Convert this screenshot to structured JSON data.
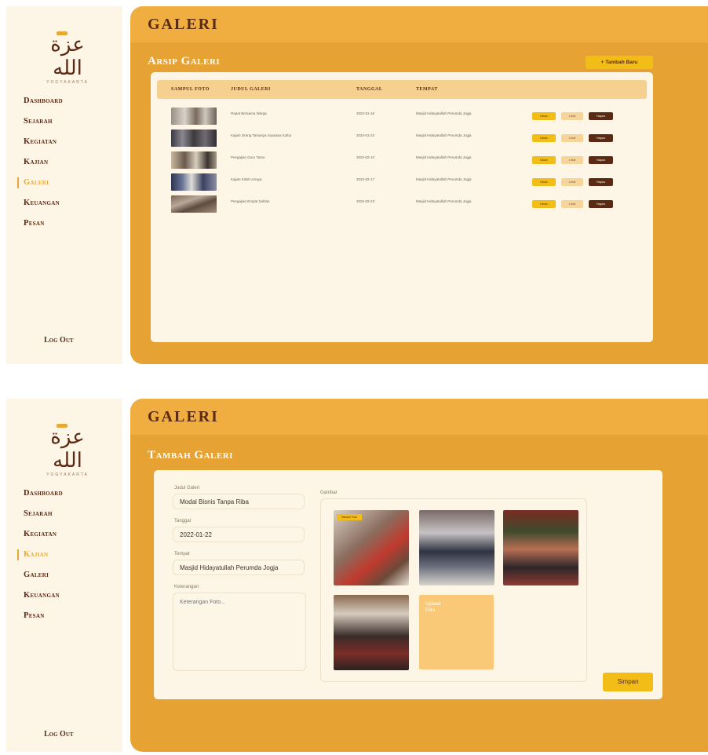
{
  "screens": [
    {
      "sidebar": {
        "logo_text": "عزة الله",
        "logo_sub": "YOGYAKARTA",
        "nav": [
          "Dashboard",
          "Sejarah",
          "Kegiatan",
          "Kajian",
          "Galeri",
          "Keuangan",
          "Pesan"
        ],
        "active": "Galeri",
        "logout": "Log Out"
      },
      "header": {
        "title": "GALERI"
      },
      "section_title": "Arsip Galeri",
      "add_button": "+ Tambah Baru",
      "table": {
        "columns": [
          "SAMPUL FOTO",
          "JUDUL GALERI",
          "TANGGAL",
          "TEMPAT"
        ],
        "rows": [
          {
            "title": "Rapat Bersama Warga",
            "date": "2022-01-16",
            "place": "Masjid Hidayatullah Perumda Jogja"
          },
          {
            "title": "Kajian Orang Tamasya Suasana Kultur",
            "date": "2022-01-23",
            "place": "Masjid Hidayatullah Perumda Jogja"
          },
          {
            "title": "Pengajian Guru Tamu",
            "date": "2022-02-10",
            "place": "Masjid Hidayatullah Perumda Jogja"
          },
          {
            "title": "Kajian Kitab Umaya",
            "date": "2022-02-17",
            "place": "Masjid Hidayatullah Perumda Jogja"
          },
          {
            "title": "Pengajian Empat Sahlan",
            "date": "2022-02-23",
            "place": "Masjid Hidayatullah Perumda Jogja"
          }
        ],
        "actions": {
          "edit": "Ubah",
          "view": "Lihat",
          "delete": "Hapus"
        }
      }
    },
    {
      "sidebar": {
        "logo_text": "عزة الله",
        "logo_sub": "YOGYAKARTA",
        "nav": [
          "Dashboard",
          "Sejarah",
          "Kegiatan",
          "Kajian",
          "Galeri",
          "Keuangan",
          "Pesan"
        ],
        "active": "Kajian",
        "logout": "Log Out"
      },
      "header": {
        "title": "GALERI"
      },
      "section_title": "Tambah Galeri",
      "form": {
        "title_label": "Judul Galeri",
        "title_value": "Modal Bisnis Tanpa Riba",
        "date_label": "Tanggal",
        "date_value": "2022-01-22",
        "place_label": "Tempat",
        "place_value": "Masjid Hidayatullah Perumda Jogja",
        "desc_label": "Keterangan",
        "desc_placeholder": "Keterangan Foto...",
        "gallery_label": "Gambar",
        "badge_text": "Sampul Foto",
        "upload_text": "Upload\nFoto",
        "save_button": "Simpan"
      }
    }
  ]
}
